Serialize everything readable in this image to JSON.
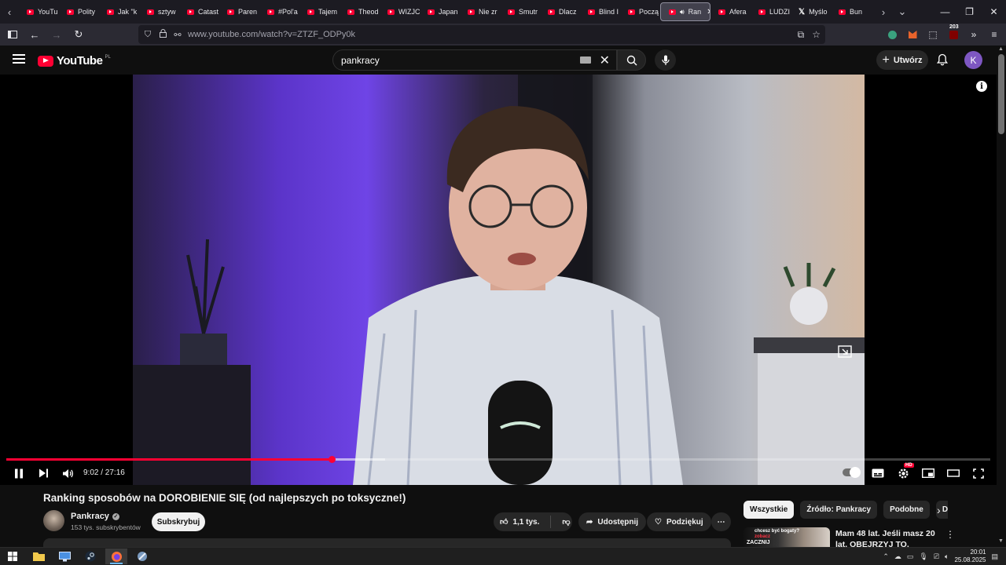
{
  "browser": {
    "tabs": [
      {
        "label": "YouTu",
        "icon": "youtube-favicon"
      },
      {
        "label": "Polity",
        "icon": "youtube-favicon"
      },
      {
        "label": "Jak \"k",
        "icon": "youtube-favicon"
      },
      {
        "label": "sztyw",
        "icon": "youtube-favicon"
      },
      {
        "label": "Catast",
        "icon": "youtube-favicon"
      },
      {
        "label": "Paren",
        "icon": "youtube-favicon"
      },
      {
        "label": "#Pol'a",
        "icon": "youtube-favicon"
      },
      {
        "label": "Tajem",
        "icon": "youtube-favicon"
      },
      {
        "label": "Theod",
        "icon": "youtube-favicon"
      },
      {
        "label": "WIZJC",
        "icon": "youtube-favicon"
      },
      {
        "label": "Japan",
        "icon": "youtube-favicon"
      },
      {
        "label": "Nie zr",
        "icon": "youtube-favicon"
      },
      {
        "label": "Smutr",
        "icon": "youtube-favicon"
      },
      {
        "label": "Dlacz",
        "icon": "youtube-favicon"
      },
      {
        "label": "Blind I",
        "icon": "youtube-favicon"
      },
      {
        "label": "Począ",
        "icon": "youtube-favicon"
      },
      {
        "label": "Ran",
        "icon": "youtube-favicon",
        "active": true
      },
      {
        "label": "Afera",
        "icon": "youtube-favicon"
      },
      {
        "label": "LUDZI",
        "icon": "youtube-favicon"
      },
      {
        "label": "Myślo",
        "icon": "x-favicon"
      },
      {
        "label": "Bun",
        "icon": "youtube-favicon"
      }
    ],
    "url": "www.youtube.com/watch?v=ZTZF_ODPy0k",
    "extension_badge": "203"
  },
  "youtube": {
    "logo_text": "YouTube",
    "region": "PL",
    "search_value": "pankracy",
    "create_label": "Utwórz",
    "avatar_letter": "K"
  },
  "player": {
    "current_time": "9:02",
    "duration": "27:16",
    "time_display": "9:02 / 27:16",
    "played_fraction": 0.331,
    "buffered_fraction": 0.385,
    "hd_badge": "HD"
  },
  "video": {
    "title": "Ranking sposobów na DOROBIENIE SIĘ (od najlepszych po toksyczne!)",
    "channel_name": "Pankracy",
    "subscribers": "153 tys. subskrybentów",
    "subscribe_label": "Subskrybuj",
    "likes": "1,1 tys.",
    "share_label": "Udostępnij",
    "thanks_label": "Podziękuj"
  },
  "recommendations": {
    "chips": [
      "Wszystkie",
      "Źródło: Pankracy",
      "Podobne",
      "Dl"
    ],
    "first_title": "Mam 48 lat. Jeśli masz 20 lat, OBEJRZYJ TO.",
    "thumb_text_1": "chcesz być bogaty?",
    "thumb_text_2": "zobacz",
    "thumb_text_3": "ZACZNIJ"
  },
  "taskbar": {
    "time": "20:01",
    "date": "25.08.2025"
  },
  "colors": {
    "accent": "#ff0033",
    "background": "#0f0f0f",
    "chip_bg": "#272727",
    "avatar": "#7e57c2"
  }
}
